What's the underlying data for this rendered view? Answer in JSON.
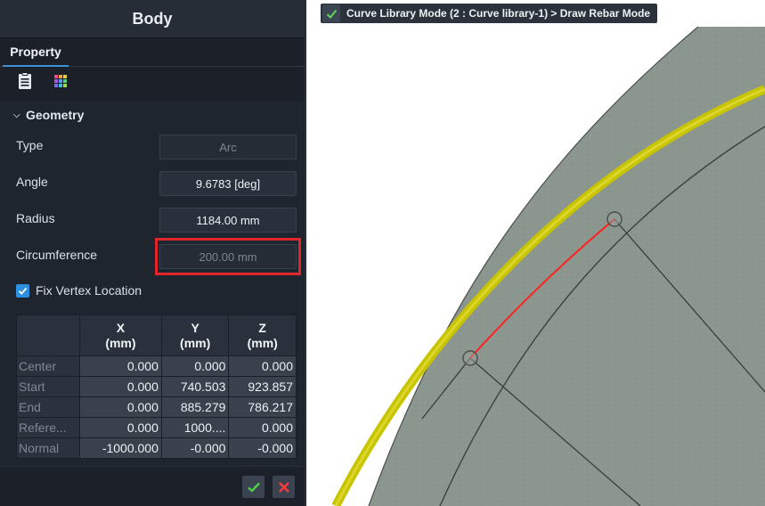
{
  "panel": {
    "title": "Body",
    "tab": "Property",
    "view_icons": [
      "properties-icon",
      "palette-icon"
    ]
  },
  "geometry": {
    "section": "Geometry",
    "type_label": "Type",
    "type_value": "Arc",
    "angle_label": "Angle",
    "angle_value": "9.6783 [deg]",
    "radius_label": "Radius",
    "radius_value": "1184.00 mm",
    "circ_label": "Circumference",
    "circ_value": "200.00 mm",
    "fix_vertex_label": "Fix Vertex Location",
    "fix_vertex_checked": true
  },
  "table": {
    "headers": [
      {
        "line1": "X",
        "line2": "(mm)"
      },
      {
        "line1": "Y",
        "line2": "(mm)"
      },
      {
        "line1": "Z",
        "line2": "(mm)"
      }
    ],
    "rows": [
      {
        "name": "Center",
        "x": "0.000",
        "y": "0.000",
        "z": "0.000"
      },
      {
        "name": "Start",
        "x": "0.000",
        "y": "740.503",
        "z": "923.857"
      },
      {
        "name": "End",
        "x": "0.000",
        "y": "885.279",
        "z": "786.217"
      },
      {
        "name": "Refere...",
        "x": "0.000",
        "y": "1000....",
        "z": "0.000"
      },
      {
        "name": "Normal",
        "x": "-1000.000",
        "y": "-0.000",
        "z": "-0.000"
      }
    ]
  },
  "viewport": {
    "mode_text": "Curve Library Mode (2 : Curve library-1) > Draw Rebar Mode"
  },
  "colors": {
    "accent": "#3d8fd6",
    "highlight": "#e0262a",
    "rebar": "#d4d000",
    "selected_segment": "#ff2020",
    "concrete": "#8a958d"
  }
}
